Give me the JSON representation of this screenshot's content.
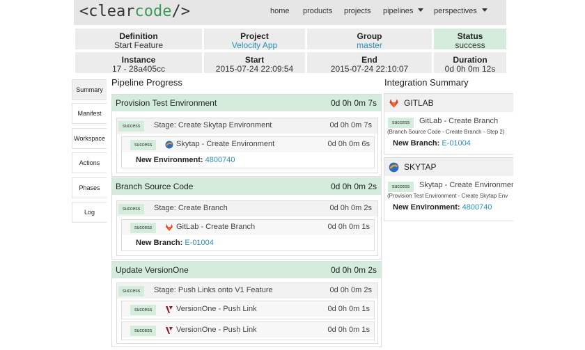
{
  "header": {
    "logo": {
      "open": "<clear",
      "accent": "code",
      "close": "/>"
    },
    "nav": [
      {
        "label": "home"
      },
      {
        "label": "products"
      },
      {
        "label": "projects"
      },
      {
        "label": "pipelines"
      },
      {
        "label": "perspectives"
      }
    ]
  },
  "info": {
    "definition": {
      "label": "Definition",
      "value": "Start Feature"
    },
    "project": {
      "label": "Project",
      "value": "Velocity App"
    },
    "group": {
      "label": "Group",
      "value": "master"
    },
    "status": {
      "label": "Status",
      "value": "success"
    },
    "instance": {
      "label": "Instance",
      "value": "17 - 28a405cc"
    },
    "start": {
      "label": "Start",
      "value": "2015-07-24 22:09:54"
    },
    "end": {
      "label": "End",
      "value": "2015-07-24 22:10:07"
    },
    "duration": {
      "label": "Duration",
      "value": "0d 0h 0m 12s"
    }
  },
  "tabs": [
    "Summary",
    "Manifest",
    "Workspace",
    "Actions",
    "Phases",
    "Log"
  ],
  "pipeline": {
    "heading": "Pipeline Progress",
    "phases": [
      {
        "title": "Provision Test Environment",
        "time": "0d 0h 0m 7s",
        "stage": {
          "badge": "success",
          "title": "Stage: Create Skytap Environment",
          "time": "0d 0h 0m 7s"
        },
        "steps": [
          {
            "badge": "success",
            "title": "Skytap - Create Environment",
            "time": "0d 0h 0m 6s"
          }
        ],
        "result": {
          "key": "New Environment:",
          "value": "4800740"
        }
      },
      {
        "title": "Branch Source Code",
        "time": "0d 0h 0m 2s",
        "stage": {
          "badge": "success",
          "title": "Stage: Create Branch",
          "time": "0d 0h 0m 2s"
        },
        "steps": [
          {
            "badge": "success",
            "title": "GitLab - Create Branch",
            "time": "0d 0h 0m 1s"
          }
        ],
        "result": {
          "key": "New Branch:",
          "value": "E-01004"
        }
      },
      {
        "title": "Update VersionOne",
        "time": "0d 0h 0m 2s",
        "stage": {
          "badge": "success",
          "title": "Stage: Push Links onto V1 Feature",
          "time": "0d 0h 0m 2s"
        },
        "steps": [
          {
            "badge": "success",
            "title": "VersionOne - Push Link",
            "time": "0d 0h 0m 1s"
          },
          {
            "badge": "success",
            "title": "VersionOne - Push Link",
            "time": "0d 0h 0m 1s"
          }
        ]
      }
    ]
  },
  "integration": {
    "heading": "Integration Summary",
    "items": [
      {
        "name": "GITLAB",
        "badge": "success",
        "title": "GitLab - Create Branch",
        "context": "(Branch Source Code - Create Branch - Step 2)",
        "key": "New Branch:",
        "value": "E-01004"
      },
      {
        "name": "SKYTAP",
        "badge": "success",
        "title": "Skytap - Create Environment",
        "context": "(Provision Test Environment - Create Skytap Env",
        "key": "New Environment:",
        "value": "4800740"
      }
    ]
  },
  "colors": {
    "accent_green": "#d3ecdb",
    "link": "#2a8fbd",
    "logo_accent": "#3a9a5b"
  }
}
